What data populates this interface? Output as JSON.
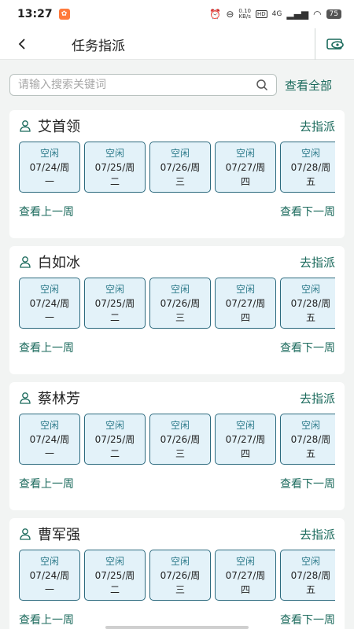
{
  "status": {
    "time": "13:27",
    "net_speed_top": "0.10",
    "net_speed_bottom": "KB/s",
    "hd": "HD",
    "network": "4G",
    "battery": "75"
  },
  "nav": {
    "back_icon": "chevron-left-icon",
    "title": "任务指派",
    "action_icon": "eye-card-icon"
  },
  "search": {
    "placeholder": "请输入搜索关键词",
    "view_all": "查看全部"
  },
  "cards": [
    {
      "name": "艾首领",
      "assign": "去指派",
      "prev_week": "查看上一周",
      "next_week": "查看下一周",
      "days": [
        {
          "status": "空闲",
          "date": "07/24/周",
          "weekday": "一"
        },
        {
          "status": "空闲",
          "date": "07/25/周",
          "weekday": "二"
        },
        {
          "status": "空闲",
          "date": "07/26/周",
          "weekday": "三"
        },
        {
          "status": "空闲",
          "date": "07/27/周",
          "weekday": "四"
        },
        {
          "status": "空闲",
          "date": "07/28/周",
          "weekday": "五"
        }
      ]
    },
    {
      "name": "白如冰",
      "assign": "去指派",
      "prev_week": "查看上一周",
      "next_week": "查看下一周",
      "days": [
        {
          "status": "空闲",
          "date": "07/24/周",
          "weekday": "一"
        },
        {
          "status": "空闲",
          "date": "07/25/周",
          "weekday": "二"
        },
        {
          "status": "空闲",
          "date": "07/26/周",
          "weekday": "三"
        },
        {
          "status": "空闲",
          "date": "07/27/周",
          "weekday": "四"
        },
        {
          "status": "空闲",
          "date": "07/28/周",
          "weekday": "五"
        }
      ]
    },
    {
      "name": "蔡林芳",
      "assign": "去指派",
      "prev_week": "查看上一周",
      "next_week": "查看下一周",
      "days": [
        {
          "status": "空闲",
          "date": "07/24/周",
          "weekday": "一"
        },
        {
          "status": "空闲",
          "date": "07/25/周",
          "weekday": "二"
        },
        {
          "status": "空闲",
          "date": "07/26/周",
          "weekday": "三"
        },
        {
          "status": "空闲",
          "date": "07/27/周",
          "weekday": "四"
        },
        {
          "status": "空闲",
          "date": "07/28/周",
          "weekday": "五"
        }
      ]
    },
    {
      "name": "曹军强",
      "assign": "去指派",
      "prev_week": "查看上一周",
      "next_week": "查看下一周",
      "days": [
        {
          "status": "空闲",
          "date": "07/24/周",
          "weekday": "一"
        },
        {
          "status": "空闲",
          "date": "07/25/周",
          "weekday": "二"
        },
        {
          "status": "空闲",
          "date": "07/26/周",
          "weekday": "三"
        },
        {
          "status": "空闲",
          "date": "07/27/周",
          "weekday": "四"
        },
        {
          "status": "空闲",
          "date": "07/28/周",
          "weekday": "五"
        }
      ]
    }
  ],
  "colors": {
    "accent": "#1b6a5c",
    "day_bg": "#e3f2f9",
    "day_border": "#2c6a7e",
    "page_bg": "#f2f4f3"
  }
}
